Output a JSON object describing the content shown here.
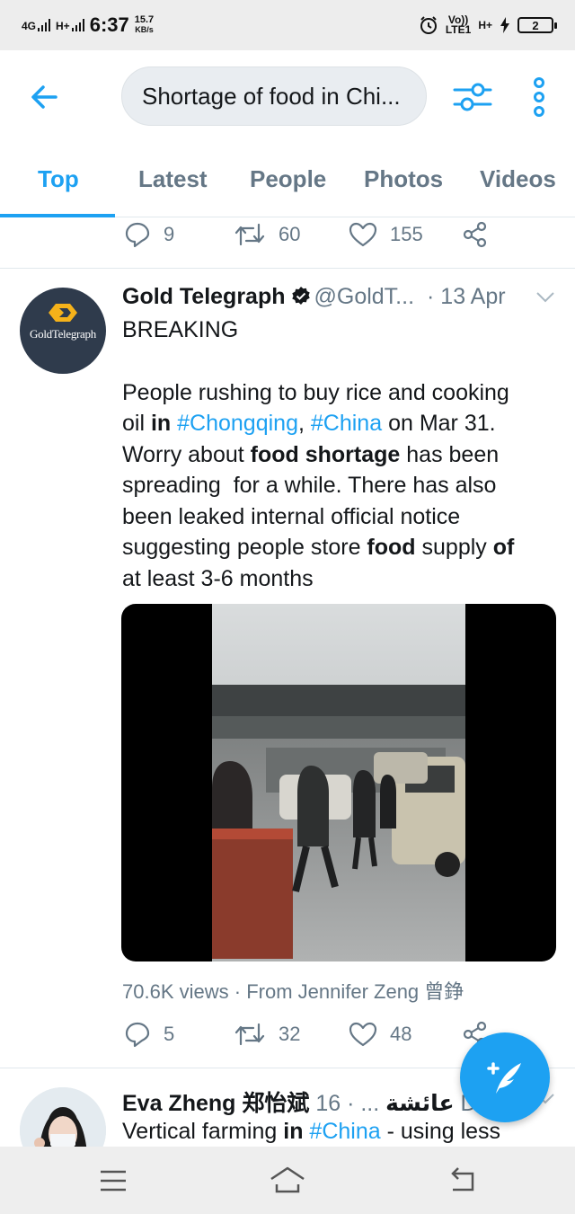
{
  "status_bar": {
    "network_left": "4G",
    "network_right": "H+",
    "time": "6:37",
    "speed_value": "15.7",
    "speed_unit": "KB/s",
    "volte": "Vo))",
    "lte": "LTE1",
    "hplus": "H+",
    "battery": "2"
  },
  "header": {
    "search_value": "Shortage of food in Chi..."
  },
  "tabs": [
    "Top",
    "Latest",
    "People",
    "Photos",
    "Videos"
  ],
  "prev_tweet_actions": {
    "replies": "9",
    "retweets": "60",
    "likes": "155"
  },
  "tweet": {
    "avatar_text": "GoldTelegraph",
    "name": "Gold Telegraph",
    "handle": "@GoldT...",
    "date": "· 13 Apr",
    "text": {
      "l1": "BREAKING",
      "l2": "People rushing to buy rice and cooking",
      "l3a": "oil ",
      "l3b": "in",
      "l3c": " ",
      "l3d": "#Chongqing",
      "l3e": ", ",
      "l3f": "#China",
      "l3g": " on Mar 31.",
      "l4a": "Worry about ",
      "l4b": "food shortage",
      "l4c": " has been",
      "l5": "spreading  for a while. There has also",
      "l6": "been leaked internal official notice",
      "l7a": "suggesting people store ",
      "l7b": "food",
      "l7c": " supply ",
      "l7d": "of",
      "l8": "at least 3-6 months"
    },
    "views": "70.6K views",
    "from": "From Jennifer Zeng 曾錚",
    "replies": "5",
    "retweets": "32",
    "likes": "48"
  },
  "tweet2": {
    "name": "Eva Zheng 郑怡斌 عائشة",
    "meta": "... · 16 De",
    "text_a": "Vertical farming ",
    "text_b": "in",
    "text_c": " ",
    "text_d": "#China",
    "text_e": " - using less"
  },
  "colors": {
    "accent": "#1da1f2",
    "muted": "#657786",
    "text": "#14171a"
  },
  "icons": [
    "back-arrow-icon",
    "filter-icon",
    "more-vertical-icon",
    "reply-icon",
    "retweet-icon",
    "like-icon",
    "share-icon",
    "verified-icon",
    "chevron-down-icon",
    "compose-icon",
    "menu-icon",
    "home-icon",
    "back-icon"
  ]
}
